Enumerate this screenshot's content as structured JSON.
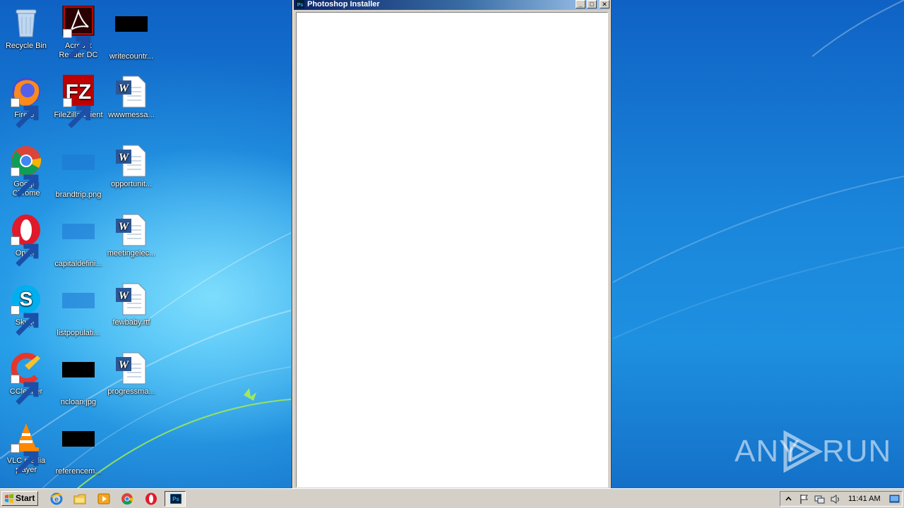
{
  "desktop": {
    "icons": [
      {
        "label": "Recycle Bin"
      },
      {
        "label": "Acrobat Reader DC"
      },
      {
        "label": "writecountr..."
      },
      {
        "label": "Firefox"
      },
      {
        "label": "FileZilla Client"
      },
      {
        "label": "wwwmessa..."
      },
      {
        "label": "Google Chrome"
      },
      {
        "label": "brandtrip.png"
      },
      {
        "label": "opportunit..."
      },
      {
        "label": "Opera"
      },
      {
        "label": "capitaldefini..."
      },
      {
        "label": "meetingelec..."
      },
      {
        "label": "Skype"
      },
      {
        "label": "listpopulati..."
      },
      {
        "label": "fewbaby.rtf"
      },
      {
        "label": "CCleaner"
      },
      {
        "label": "ncloan.jpg"
      },
      {
        "label": "progressma..."
      },
      {
        "label": "VLC media player"
      },
      {
        "label": "referencem..."
      }
    ]
  },
  "window": {
    "title": "Photoshop Installer",
    "minimize": "_",
    "maximize": "□",
    "close": "✕"
  },
  "watermark": {
    "text_left": "ANY",
    "text_right": "RUN"
  },
  "taskbar": {
    "start_label": "Start",
    "clock": "11:41 AM",
    "colors": {
      "bg": "#d4d0c8",
      "title_start": "#0a246a",
      "title_end": "#a6caf0"
    }
  }
}
